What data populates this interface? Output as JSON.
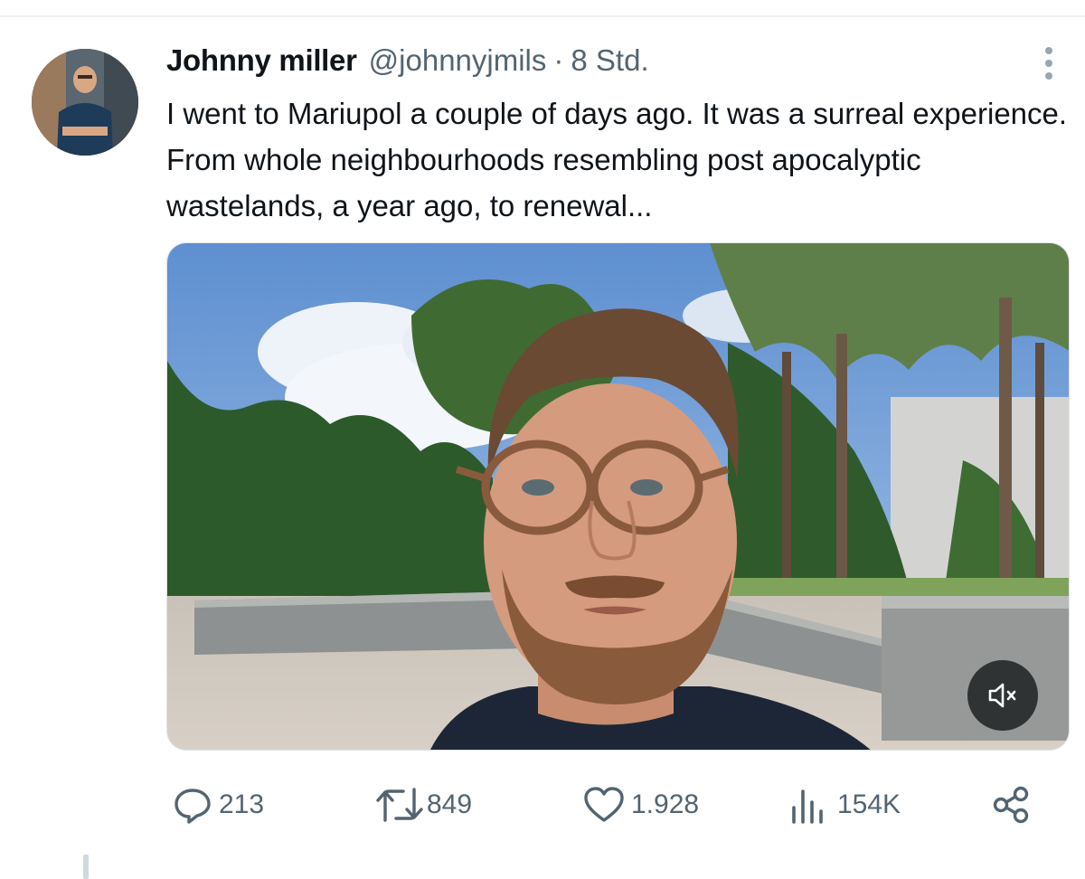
{
  "tweet": {
    "display_name": "Johnny miller",
    "handle": "@johnnyjmils",
    "separator": "·",
    "time": "8 Std.",
    "text": "I went to Mariupol a couple of days ago. It was a surreal experience. From whole neighbourhoods resembling post apocalyptic wastelands, a year ago, to renewal..."
  },
  "media": {
    "type": "video",
    "muted": true,
    "icon": "speaker-muted-icon"
  },
  "actions": {
    "replies": {
      "icon": "reply-icon",
      "count": "213"
    },
    "retweets": {
      "icon": "retweet-icon",
      "count": "849"
    },
    "likes": {
      "icon": "heart-icon",
      "count": "1.928"
    },
    "views": {
      "icon": "views-chart-icon",
      "count": "154K"
    },
    "share": {
      "icon": "share-icon"
    }
  },
  "colors": {
    "text_primary": "#0f1419",
    "text_secondary": "#536471",
    "divider": "#eceff1"
  }
}
